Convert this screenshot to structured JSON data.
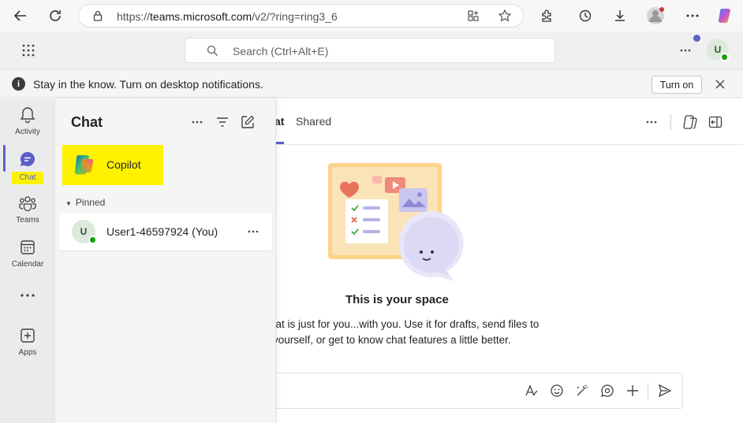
{
  "browser": {
    "url_scheme": "https://",
    "url_host": "teams.microsoft.com",
    "url_path": "/v2/?ring=ring3_6"
  },
  "search": {
    "placeholder": "Search (Ctrl+Alt+E)"
  },
  "profile": {
    "initial": "U"
  },
  "banner": {
    "message": "Stay in the know. Turn on desktop notifications.",
    "button_label": "Turn on"
  },
  "rail": {
    "items": [
      {
        "label": "Activity",
        "icon": "bell-icon"
      },
      {
        "label": "Chat",
        "icon": "chat-icon"
      },
      {
        "label": "Teams",
        "icon": "teams-icon"
      },
      {
        "label": "Calendar",
        "icon": "calendar-icon"
      },
      {
        "label": "",
        "icon": "more-icon"
      },
      {
        "label": "Apps",
        "icon": "apps-icon"
      }
    ]
  },
  "chat_pane": {
    "title": "Chat",
    "copilot_label": "Copilot",
    "pinned_header": "Pinned",
    "pinned": [
      {
        "initial": "U",
        "name": "User1-46597924 (You)"
      }
    ]
  },
  "main": {
    "tabs": [
      {
        "label": "at"
      },
      {
        "label": "Shared"
      }
    ],
    "empty_title": "This is your space",
    "empty_line1": "hat is just for you...with you. Use it for drafts, send files to",
    "empty_line2": "yourself, or get to know chat features a little better."
  },
  "colors": {
    "accent": "#5b5fc7",
    "highlight": "#fff200",
    "presence": "#13a10e"
  }
}
